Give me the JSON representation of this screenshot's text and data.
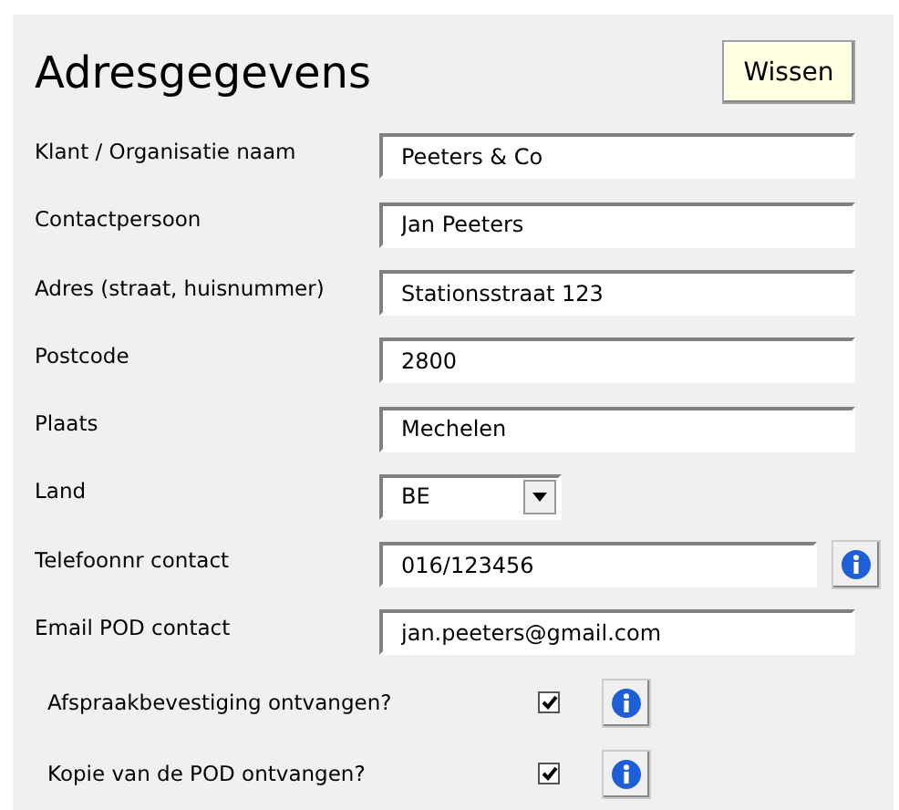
{
  "title": "Adresgegevens",
  "clear_button": "Wissen",
  "fields": [
    {
      "label": "Klant / Organisatie naam",
      "kind": "text",
      "value": "Peeters & Co",
      "info": false
    },
    {
      "label": "Contactpersoon",
      "kind": "text",
      "value": "Jan Peeters",
      "info": false
    },
    {
      "label": "Adres (straat, huisnummer)",
      "kind": "text",
      "value": "Stationsstraat 123",
      "info": false
    },
    {
      "label": "Postcode",
      "kind": "text",
      "value": "2800",
      "info": false
    },
    {
      "label": "Plaats",
      "kind": "text",
      "value": "Mechelen",
      "info": false
    },
    {
      "label": "Land",
      "kind": "select",
      "value": "BE",
      "info": false
    },
    {
      "label": "Telefoonnr contact",
      "kind": "text",
      "value": "016/123456",
      "info": true
    },
    {
      "label": "Email POD contact",
      "kind": "text",
      "value": "jan.peeters@gmail.com",
      "info": false
    }
  ],
  "checks": [
    {
      "label": "Afspraakbevestiging ontvangen?",
      "checked": true
    },
    {
      "label": "Kopie van de POD ontvangen?",
      "checked": true
    }
  ]
}
